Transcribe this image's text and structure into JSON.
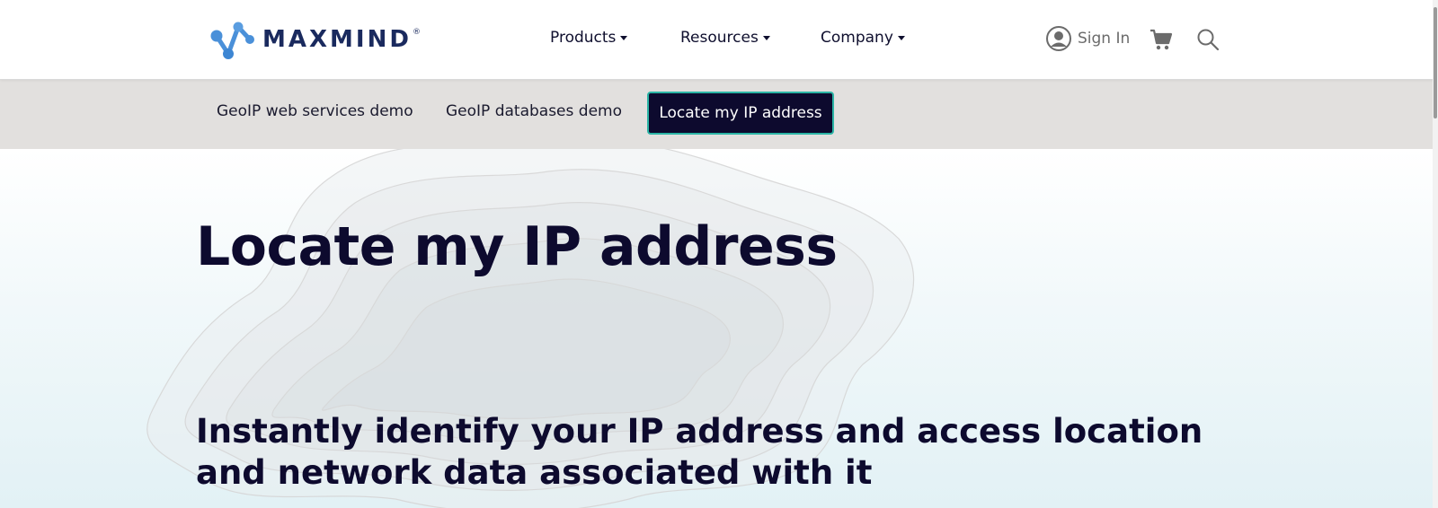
{
  "brand": {
    "name": "MAXMIND",
    "registered_mark": "®"
  },
  "nav": {
    "products": "Products",
    "resources": "Resources",
    "company": "Company",
    "sign_in": "Sign In"
  },
  "subnav": {
    "tabs": [
      {
        "label": "GeoIP web services demo"
      },
      {
        "label": "GeoIP databases demo"
      },
      {
        "label": "Locate my IP address",
        "active": true
      }
    ]
  },
  "hero": {
    "title": "Locate my IP address",
    "subtitle": "Instantly identify your IP address and access location and network data associated with it"
  },
  "icons": {
    "logo": "maxmind-logo-icon",
    "caret": "caret-down-icon",
    "user": "user-circle-icon",
    "cart": "shopping-cart-icon",
    "search": "search-icon"
  },
  "colors": {
    "navy": "#0d0a2e",
    "brand_blue": "#4a90d9",
    "accent_teal": "#2bb5a6",
    "subnav_bg": "#e2e0de"
  }
}
